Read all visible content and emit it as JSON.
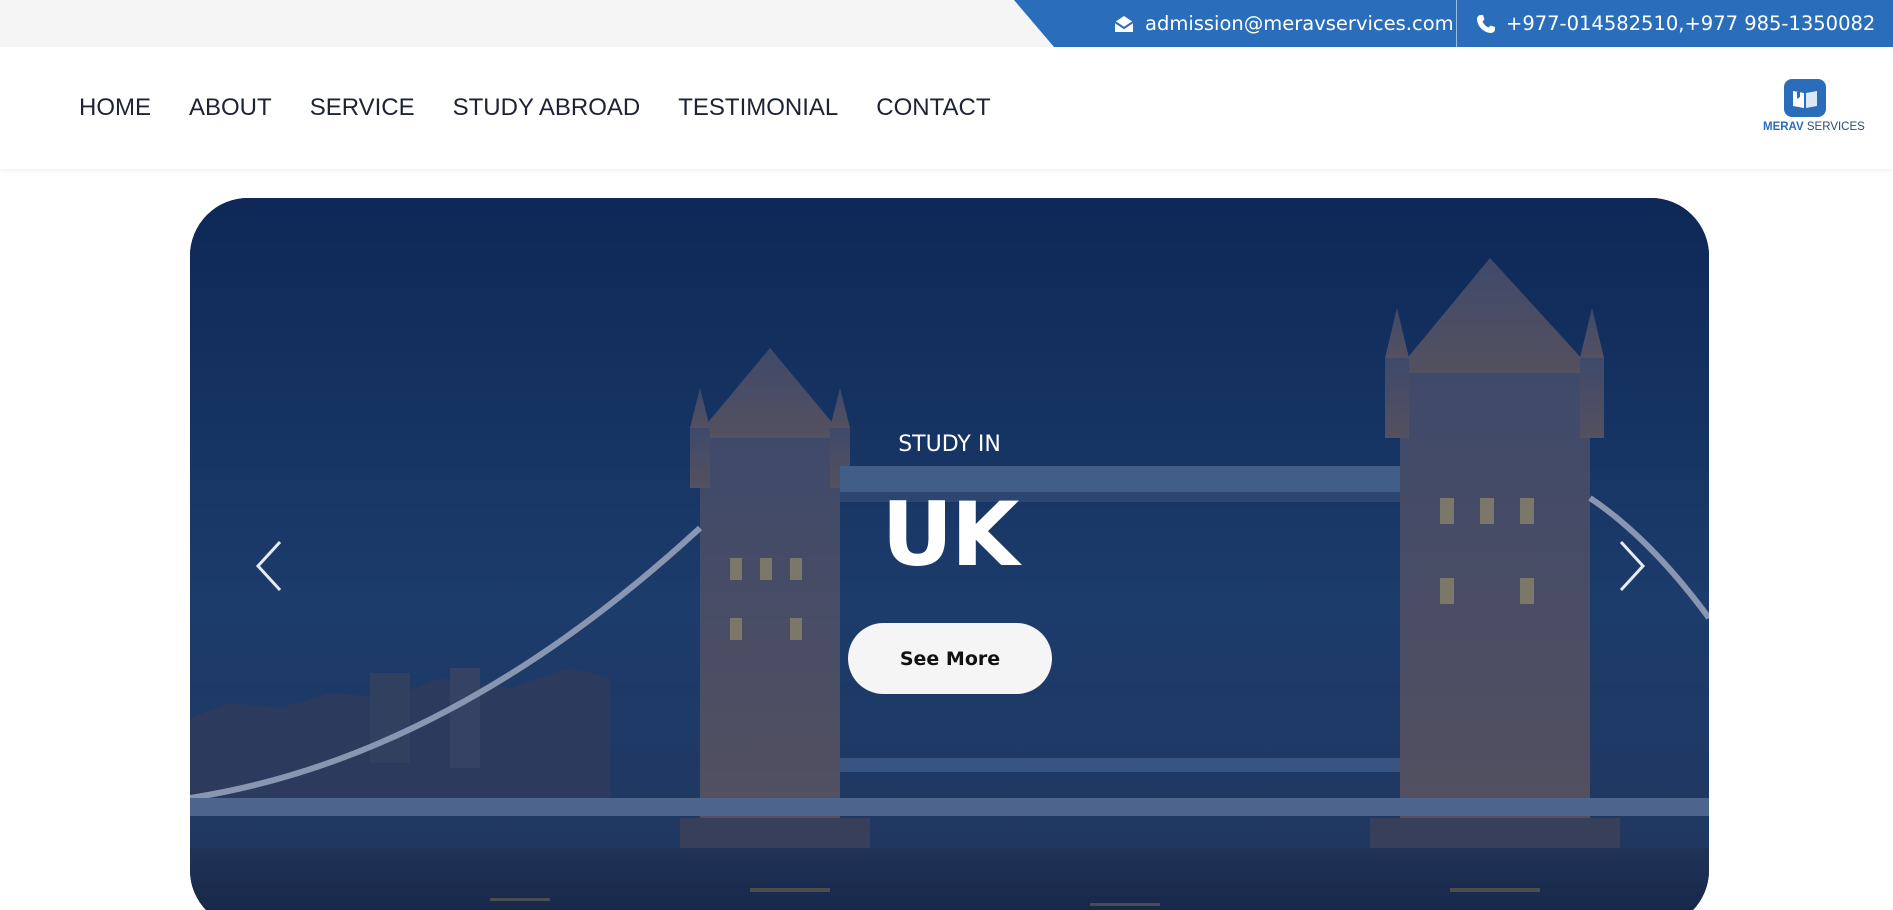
{
  "topbar": {
    "email": "admission@meravservices.com",
    "phone": "+977-014582510,+977 985-1350082",
    "brand_color": "#2a6ebb"
  },
  "nav": {
    "items": [
      "HOME",
      "ABOUT",
      "SERVICE",
      "STUDY ABROAD",
      "TESTIMONIAL",
      "CONTACT"
    ]
  },
  "logo": {
    "word1": "MERAV",
    "word2": " SERVICES"
  },
  "hero": {
    "subtitle": "STUDY IN",
    "title": "UK",
    "button_label": "See More"
  },
  "icons": {
    "email": "envelope-icon",
    "phone": "phone-icon",
    "prev": "chevron-left-icon",
    "next": "chevron-right-icon"
  }
}
